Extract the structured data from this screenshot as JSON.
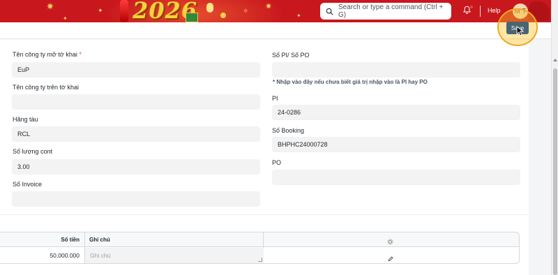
{
  "navbar": {
    "banner_text": "2026",
    "search_placeholder": "Search or type a command (Ctrl + G)",
    "help_label": "Help",
    "avatar_initials": "M T",
    "colors": {
      "background": "#c8171d",
      "banner_gold": "#ffcf3f"
    }
  },
  "toolbar": {
    "save_label": "Save",
    "save_color": "#4a6572"
  },
  "form": {
    "left": [
      {
        "label": "Tên công ty mở tờ khai",
        "required": "*",
        "value": "EuP"
      },
      {
        "label": "Tên công ty trên tờ khai",
        "value": ""
      },
      {
        "label": "Hãng tàu",
        "value": "RCL"
      },
      {
        "label": "Số lượng cont",
        "value": "3.00"
      },
      {
        "label": "Số Invoice",
        "value": ""
      }
    ],
    "right": [
      {
        "label": "Số PI/ Số PO",
        "value": ""
      },
      {
        "label": "PI",
        "value": "24-0286"
      },
      {
        "label": "Số Booking",
        "value": "BHPHC24000728"
      },
      {
        "label": "PO",
        "value": ""
      }
    ],
    "hint": "* Nhập vào đây nếu chưa biết giá trị nhập vào là PI hay PO"
  },
  "child_table": {
    "columns": [
      "Số tiền",
      "Ghi chú"
    ],
    "rows": [
      {
        "amount": "50,000.000",
        "note_placeholder": "Ghi chú"
      }
    ],
    "icons": {
      "header": "gear-icon",
      "row": "edit-icon"
    }
  }
}
